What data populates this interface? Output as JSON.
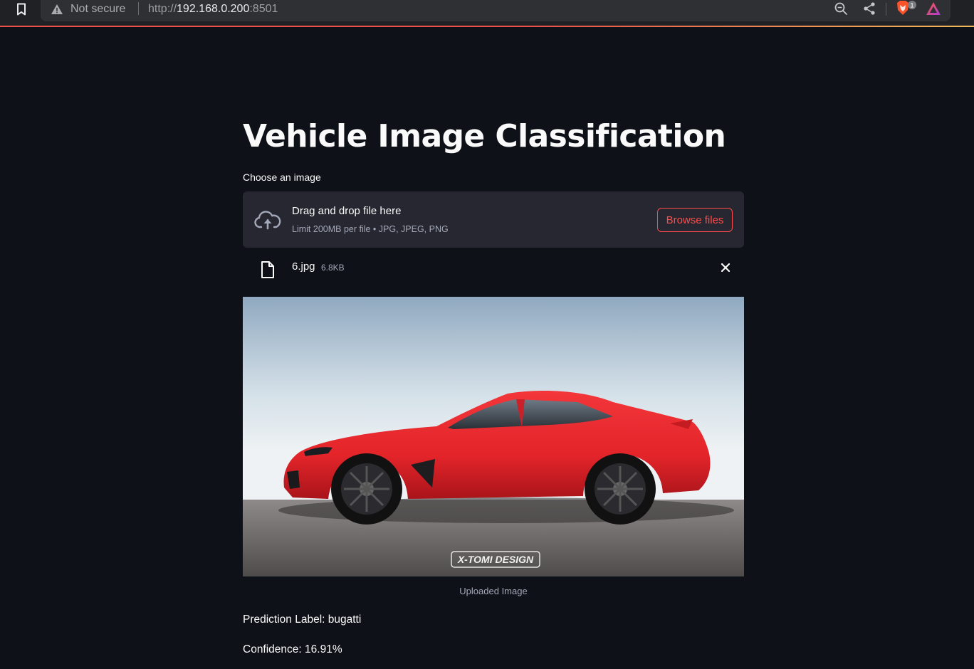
{
  "browser": {
    "security": "Not secure",
    "url_scheme": "http://",
    "url_host": "192.168.0.200",
    "url_port": ":8501",
    "brave_badge": "1"
  },
  "page": {
    "title": "Vehicle Image Classification"
  },
  "uploader": {
    "label": "Choose an image",
    "drop_title": "Drag and drop file here",
    "limit_text": "Limit 200MB per file • JPG, JPEG, PNG",
    "browse_label": "Browse files"
  },
  "file": {
    "name": "6.jpg",
    "size": "6.8KB"
  },
  "image": {
    "watermark": "X-TOMI DESIGN",
    "caption": "Uploaded Image"
  },
  "result": {
    "prediction": "Prediction Label: bugatti",
    "confidence": "Confidence: 16.91%"
  },
  "colors": {
    "background": "#0e1117",
    "dropzone": "#262730",
    "accent": "#ff4b4b",
    "car_body": "#e8262b"
  },
  "icons": [
    "bookmark-icon",
    "warning-icon",
    "zoom-out-icon",
    "share-icon",
    "brave-shield-icon",
    "brave-rewards-icon",
    "cloud-upload-icon",
    "file-icon",
    "close-icon"
  ]
}
